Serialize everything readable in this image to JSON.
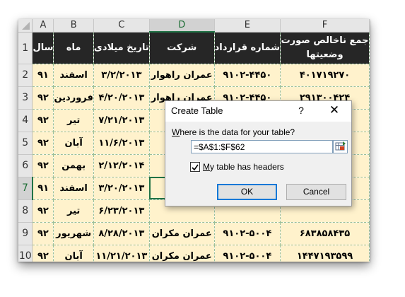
{
  "columns": [
    "A",
    "B",
    "C",
    "D",
    "E",
    "F"
  ],
  "rows": [
    "1",
    "2",
    "3",
    "4",
    "5",
    "6",
    "7",
    "8",
    "9",
    "10"
  ],
  "header": {
    "year": "سال",
    "month": "ماه",
    "date": "تاریخ میلادی",
    "company": "شرکت",
    "contract": "شماره قرارداد",
    "total_line1": "جمع ناخالص صورت",
    "total_line2": "وضعیتها"
  },
  "data_rows": [
    {
      "year": "۹۱",
      "month": "اسفند",
      "date": "۳/۲/۲۰۱۳",
      "company": "عمران راهوار",
      "contract": "۹۱۰۲-۴۴۵۰",
      "total": "۴۰۱۷۱۹۲۷۰"
    },
    {
      "year": "۹۲",
      "month": "فروردین",
      "date": "۴/۲۰/۲۰۱۳",
      "company": "عمران راهوار",
      "contract": "۹۱۰۲-۴۴۵۰",
      "total": "۲۹۱۳۰۰۴۲۴"
    },
    {
      "year": "۹۲",
      "month": "تیر",
      "date": "۷/۲۱/۲۰۱۳",
      "company": "",
      "contract": "",
      "total": ""
    },
    {
      "year": "۹۲",
      "month": "آبان",
      "date": "۱۱/۶/۲۰۱۳",
      "company": "",
      "contract": "",
      "total": ""
    },
    {
      "year": "۹۲",
      "month": "بهمن",
      "date": "۲/۱۲/۲۰۱۴",
      "company": "",
      "contract": "",
      "total": ""
    },
    {
      "year": "۹۱",
      "month": "اسفند",
      "date": "۳/۲۰/۲۰۱۳",
      "company": "",
      "contract": "",
      "total": ""
    },
    {
      "year": "۹۲",
      "month": "تیر",
      "date": "۶/۲۳/۲۰۱۳",
      "company": "",
      "contract": "",
      "total": ""
    },
    {
      "year": "۹۲",
      "month": "شهریور",
      "date": "۸/۲۸/۲۰۱۳",
      "company": "عمران مکران",
      "contract": "۹۱۰۲-۵۰۰۴",
      "total": "۶۸۳۸۵۸۴۳۵"
    },
    {
      "year": "۹۲",
      "month": "آبان",
      "date": "۱۱/۲۱/۲۰۱۳",
      "company": "عمران مکران",
      "contract": "۹۱۰۲-۵۰۰۴",
      "total": "۱۴۴۷۱۹۳۵۹۹"
    }
  ],
  "dialog": {
    "title": "Create Table",
    "help": "?",
    "close": "✕",
    "prompt_underlined": "W",
    "prompt_rest": "here is the data for your table?",
    "range_value": "=$A$1:$F$62",
    "checkbox_checked": true,
    "checkbox_mark": "✓",
    "checkbox_label_underlined": "M",
    "checkbox_label_rest": "y table has headers",
    "ok_label": "OK",
    "cancel_label": "Cancel"
  },
  "colors": {
    "header_bg": "#262626",
    "data_bg": "#fff2cc",
    "selection_green": "#217346"
  }
}
